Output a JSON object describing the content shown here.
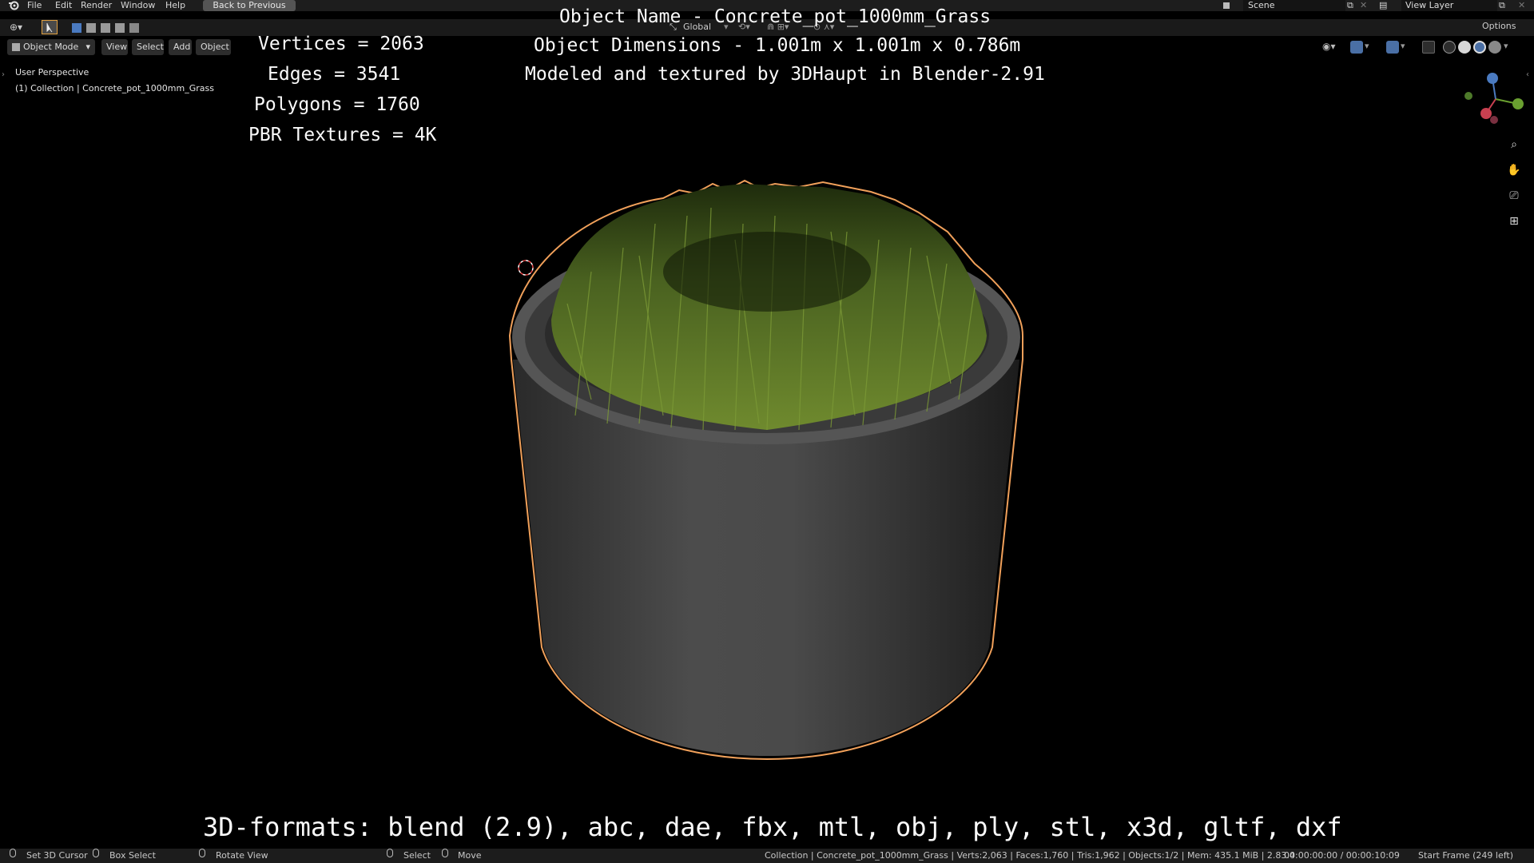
{
  "menu": {
    "file": "File",
    "edit": "Edit",
    "render": "Render",
    "window": "Window",
    "help": "Help",
    "back": "Back to Previous"
  },
  "workspace": {
    "scene": "Scene",
    "view_layer": "View Layer",
    "options": "Options"
  },
  "header": {
    "mode": "Object Mode",
    "view": "View",
    "select": "Select",
    "add": "Add",
    "object": "Object",
    "orientation": "Global"
  },
  "viewport": {
    "perspective": "User Perspective",
    "collection": "(1) Collection | Concrete_pot_1000mm_Grass"
  },
  "overlay": {
    "vertices": "Vertices = 2063",
    "edges": "Edges = 3541",
    "polygons": "Polygons = 1760",
    "textures": "PBR Textures = 4K",
    "object_name": "Object Name - Concrete_pot_1000mm_Grass",
    "dimensions": "Object Dimensions -  1.001m x 1.001m x 0.786m",
    "credits": "Modeled and textured by 3DHaupt in Blender-2.91",
    "formats": "3D-formats: blend (2.9), abc, dae, fbx, mtl, obj, ply, stl, x3d, gltf, dxf"
  },
  "status": {
    "cursor": "Set 3D Cursor",
    "box_select": "Box Select",
    "rotate": "Rotate View",
    "select": "Select",
    "move": "Move",
    "stats": "Collection | Concrete_pot_1000mm_Grass | Verts:2,063 | Faces:1,760 | Tris:1,962 | Objects:1/2 | Mem: 435.1 MiB | 2.83.4",
    "time": "00:00:00:00 / 00:00:10:09",
    "frame": "Start Frame (249 left)"
  },
  "colors": {
    "selection_outline": "#f0a05a",
    "grass_light": "#6f8a2e",
    "grass_dark": "#1e2b0c",
    "concrete": "#4a4a4a"
  },
  "icons": [
    "blender-logo-icon",
    "editor-type-icon",
    "select-cursor-icon",
    "selection-mode-icons",
    "orientation-icon",
    "snap-icon",
    "proportional-icon",
    "render-engine-icon",
    "visibility-icon",
    "gizmo-icon",
    "overlay-icon",
    "xray-icon",
    "shading-wireframe-icon",
    "shading-solid-icon",
    "shading-material-icon",
    "shading-rendered-icon",
    "zoom-icon",
    "pan-hand-icon",
    "camera-icon",
    "grid-icon",
    "mouse-left-icon",
    "mouse-right-icon",
    "mouse-middle-icon"
  ]
}
